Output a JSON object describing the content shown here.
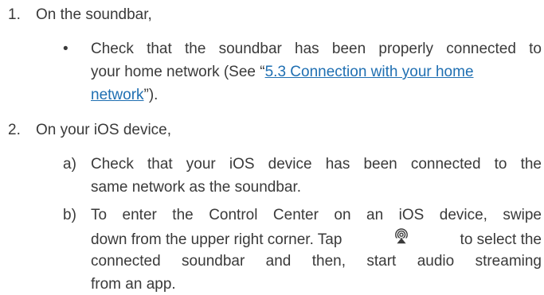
{
  "step1": {
    "number": "1.",
    "heading": "On the soundbar,",
    "bullet_symbol": "•",
    "bullet": {
      "line1": "Check that the soundbar has been properly connected to",
      "line2_before": "your home network (See “",
      "link_part1": "5.3 Connection with your home",
      "link_part2": "network",
      "line3_after": "”)."
    }
  },
  "step2": {
    "number": "2.",
    "heading": "On your iOS device,",
    "item_a": {
      "marker": "a)",
      "line1": "Check that your iOS device has been connected to the",
      "line2": "same network as the soundbar."
    },
    "item_b": {
      "marker": "b)",
      "line1": "To enter the Control Center on an iOS device, swipe",
      "line2_before": "down from the upper right corner. Tap",
      "line2_after": "to select the",
      "line3": "connected soundbar and then, start audio streaming",
      "line4": "from an app."
    }
  },
  "icons": {
    "airplay": "airplay-audio-icon"
  },
  "colors": {
    "text": "#3a3a3a",
    "link": "#1f6fb2"
  }
}
